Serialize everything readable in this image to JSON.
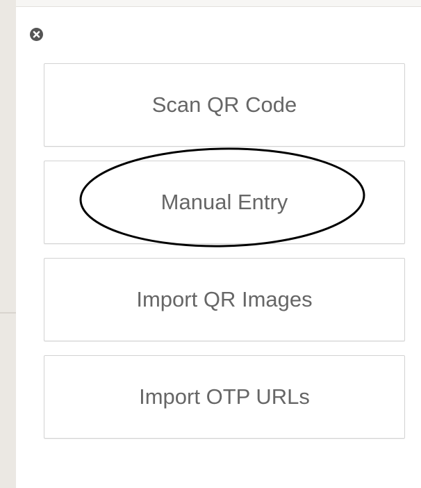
{
  "menu": {
    "close_icon": "close-circle-icon",
    "buttons": [
      {
        "label": "Scan QR Code"
      },
      {
        "label": "Manual Entry"
      },
      {
        "label": "Import QR Images"
      },
      {
        "label": "Import OTP URLs"
      }
    ]
  },
  "highlight": {
    "target": "Manual Entry",
    "color": "#000000"
  },
  "colors": {
    "button_text": "#666666",
    "button_border": "#d2d2d2",
    "left_strip": "#ebe8e3",
    "close_icon": "#555555"
  }
}
